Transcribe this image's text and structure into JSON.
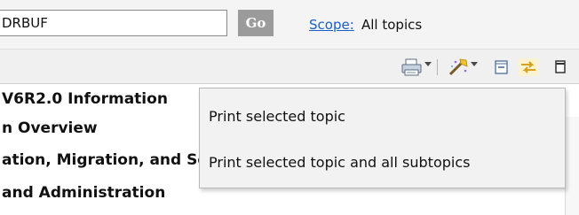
{
  "search": {
    "value": "DRBUF",
    "go_label": "Go"
  },
  "scope": {
    "link_label": "Scope:",
    "value": "All topics"
  },
  "toolbar": {
    "icons": [
      "print-icon",
      "highlight-icon",
      "collapse-all-icon",
      "sync-toc-icon",
      "maximize-icon"
    ]
  },
  "tree": {
    "items": [
      "V6R2.0 Information",
      "n Overview",
      "ation, Migration, and Service",
      "and Administration"
    ]
  },
  "menu": {
    "items": [
      "Print selected topic",
      "Print selected topic and all subtopics"
    ]
  }
}
